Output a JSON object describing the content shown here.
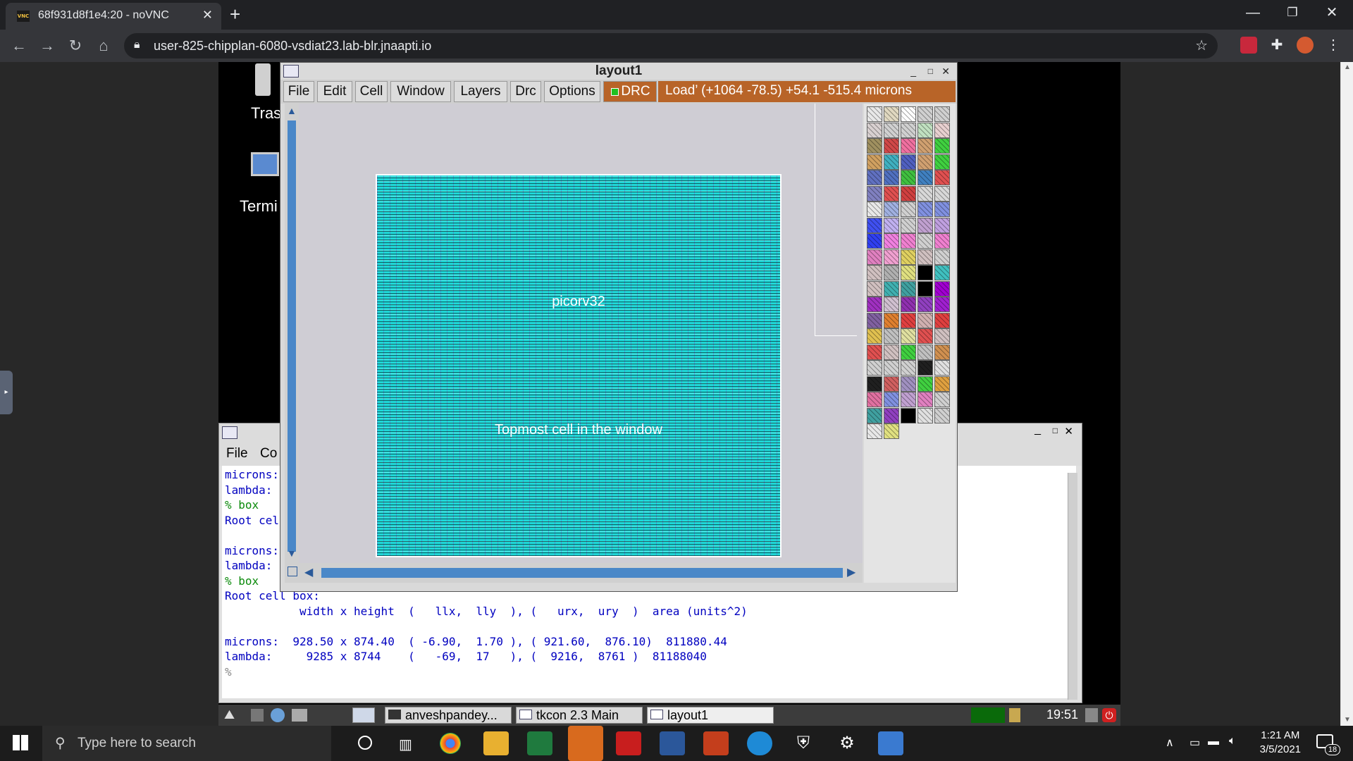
{
  "browser": {
    "tab_title": "68f931d8f1e4:20 - noVNC",
    "favicon_text": "VNC",
    "url": "user-825-chipplan-6080-vsdiat23.lab-blr.jnaapti.io"
  },
  "desktop": {
    "icons": [
      {
        "label": "Tras"
      },
      {
        "label": "Termi"
      }
    ]
  },
  "layout_window": {
    "title": "layout1",
    "menu": [
      "File",
      "Edit",
      "Cell",
      "Window",
      "Layers",
      "Drc",
      "Options"
    ],
    "drc_label": "DRC",
    "status": "Load’   (+1064 -78.5) +54.1 -515.4 microns",
    "cell_name": "picorv32",
    "cell_note": "Topmost cell in the window"
  },
  "tkcon_window": {
    "menu": [
      "File",
      "Co"
    ],
    "lines": [
      {
        "text": "microns:",
        "color": "blue"
      },
      {
        "text": "lambda:",
        "color": "blue"
      },
      {
        "text": "% box",
        "color": "green"
      },
      {
        "text": "Root cel",
        "color": "blue"
      },
      {
        "text": "",
        "color": "blue"
      },
      {
        "text": "microns:",
        "color": "blue"
      },
      {
        "text": "lambda:",
        "color": "blue"
      },
      {
        "text": "% box",
        "color": "green"
      },
      {
        "text": "Root cell box:",
        "color": "blue"
      },
      {
        "text": "           width x height  (   llx,  lly  ), (   urx,  ury  )  area (units^2)",
        "color": "blue"
      },
      {
        "text": "",
        "color": "blue"
      },
      {
        "text": "microns:  928.50 x 874.40  ( -6.90,  1.70 ), ( 921.60,  876.10)  811880.44",
        "color": "blue"
      },
      {
        "text": "lambda:     9285 x 8744    (   -69,  17   ), (  9216,  8761 )  81188040",
        "color": "blue"
      },
      {
        "text": "%",
        "color": "gray"
      }
    ]
  },
  "vnc_taskbar": {
    "items": [
      "anveshpandey...",
      "tkcon 2.3 Main",
      "layout1"
    ],
    "clock": "19:51"
  },
  "windows_taskbar": {
    "search_placeholder": "Type here to search",
    "time": "1:21 AM",
    "date": "3/5/2021",
    "notifications": "18"
  }
}
